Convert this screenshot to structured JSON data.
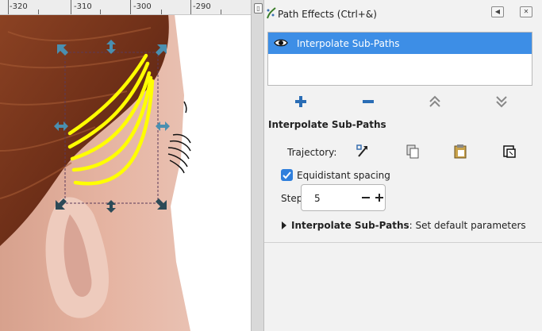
{
  "ruler": {
    "labels": [
      "-320",
      "-310",
      "-300",
      "-290"
    ]
  },
  "panel": {
    "title": "Path Effects (Ctrl+&)",
    "effects": [
      {
        "name": "Interpolate Sub-Paths",
        "visible": true,
        "selected": true
      }
    ],
    "list_controls": [
      "add-icon",
      "remove-icon",
      "move-up-icon",
      "move-down-icon"
    ],
    "section_title": "Interpolate Sub-Paths",
    "trajectory_label": "Trajectory:",
    "trajectory_buttons": [
      "edit-on-canvas-icon",
      "copy-path-icon",
      "paste-path-icon",
      "link-to-path-icon"
    ],
    "equidistant_label": "Equidistant spacing",
    "equidistant_checked": true,
    "steps_label": "Steps:",
    "steps_value": "5",
    "defaults_bold": "Interpolate Sub-Paths",
    "defaults_rest": ": Set default parameters"
  },
  "colors": {
    "selection": "#3d8ee6",
    "path": "#ffff00",
    "hair": "#7a3a1c",
    "skin": "#e2b19f"
  }
}
